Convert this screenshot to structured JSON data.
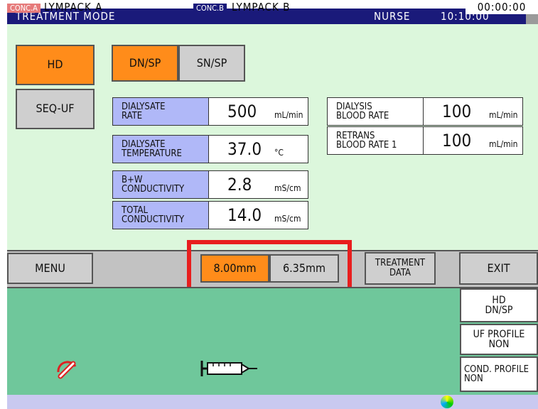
{
  "header": {
    "title": "TREATMENT MODE",
    "user": "NURSE",
    "clock": "10:10:00"
  },
  "mode_buttons": {
    "hd": "HD",
    "seq_uf": "SEQ-UF",
    "dn_sp": "DN/SP",
    "sn_sp": "SN/SP"
  },
  "params_left": [
    {
      "label1": "DIALYSATE",
      "label2": "RATE",
      "value": "500",
      "unit": "mL/min"
    },
    {
      "label1": "DIALYSATE",
      "label2": "TEMPERATURE",
      "value": "37.0",
      "unit": "°C"
    },
    {
      "label1": "B+W",
      "label2": "CONDUCTIVITY",
      "value": "2.8",
      "unit": "mS/cm"
    },
    {
      "label1": "TOTAL",
      "label2": "CONDUCTIVITY",
      "value": "14.0",
      "unit": "mS/cm"
    }
  ],
  "params_right": [
    {
      "label1": "DIALYSIS",
      "label2": "BLOOD RATE",
      "value": "100",
      "unit": "mL/min"
    },
    {
      "label1": "RETRANS",
      "label2": "BLOOD RATE 1",
      "value": "100",
      "unit": "mL/min"
    }
  ],
  "menubar": {
    "menu": "MENU",
    "size_a": "8.00mm",
    "size_b": "6.35mm",
    "treatment_data_1": "TREATMENT",
    "treatment_data_2": "DATA",
    "exit": "EXIT"
  },
  "side_info": {
    "mode_1": "HD",
    "mode_2": "DN/SP",
    "uf_profile_1": "UF PROFILE",
    "uf_profile_2": "NON",
    "cond_profile_1": "COND. PROFILE",
    "cond_profile_2": "NON"
  },
  "status": {
    "conc_a_tag": "CONC.A",
    "conc_a_value": "LYMPACK A",
    "conc_b_tag": "CONC.B",
    "conc_b_value": "LYMPACK B",
    "timer": "00:00:00"
  },
  "icons": {
    "syringe": "syringe-icon",
    "gauge": "pressure-gauge-icon",
    "status": "status-indicator-icon"
  },
  "colors": {
    "accent": "#ff8c1a",
    "highlight_frame": "#e81e1e",
    "header": "#1a1a7a"
  }
}
